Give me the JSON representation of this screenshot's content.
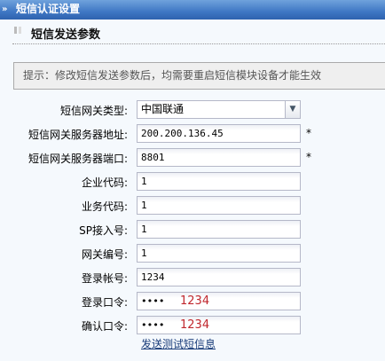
{
  "header": {
    "title": "短信认证设置",
    "arrow": "»"
  },
  "section": {
    "title": "短信发送参数"
  },
  "tip": "提示：修改短信发送参数后，均需要重启短信模块设备才能生效",
  "fields": [
    {
      "label": "短信网关类型:",
      "value": "中国联通",
      "type": "select"
    },
    {
      "label": "短信网关服务器地址:",
      "value": "200.200.136.45",
      "required": "*"
    },
    {
      "label": "短信网关服务器端口:",
      "value": "8801",
      "required": "*"
    },
    {
      "label": "企业代码:",
      "value": "1"
    },
    {
      "label": "业务代码:",
      "value": "1"
    },
    {
      "label": "SP接入号:",
      "value": "1"
    },
    {
      "label": "网关编号:",
      "value": "1"
    },
    {
      "label": "登录帐号:",
      "value": "1234"
    },
    {
      "label": "登录口令:",
      "value": "••••",
      "annotation": "1234"
    },
    {
      "label": "确认口令:",
      "value": "••••",
      "annotation": "1234"
    }
  ],
  "link": "发送测试短信息"
}
